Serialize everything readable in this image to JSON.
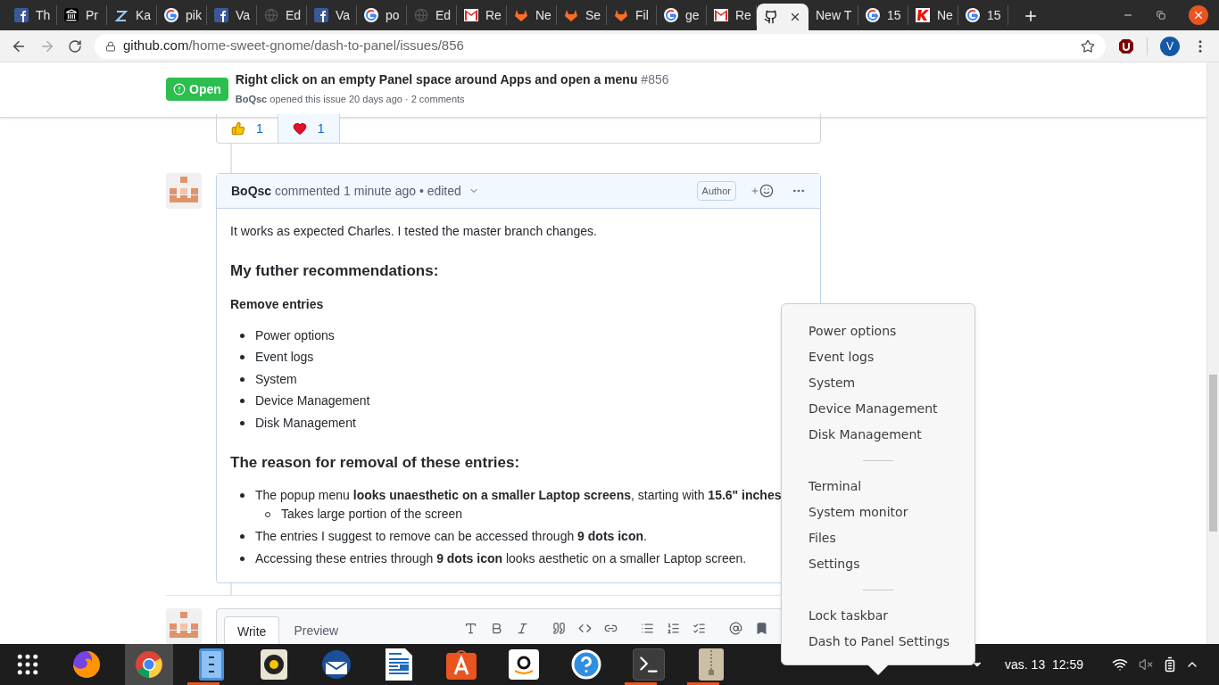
{
  "tabs": [
    {
      "label": "Th",
      "kind": "facebook",
      "selected": false
    },
    {
      "label": "Pr",
      "kind": "bank",
      "selected": false
    },
    {
      "label": "Ka",
      "kind": "z",
      "selected": false
    },
    {
      "label": "pik",
      "kind": "google",
      "selected": false
    },
    {
      "label": "Va",
      "kind": "facebook",
      "selected": false
    },
    {
      "label": "Ed",
      "kind": "globe",
      "selected": false
    },
    {
      "label": "Va",
      "kind": "facebook",
      "selected": false
    },
    {
      "label": "po",
      "kind": "google",
      "selected": false
    },
    {
      "label": "Ed",
      "kind": "globe",
      "selected": false
    },
    {
      "label": "Re",
      "kind": "mail",
      "selected": false
    },
    {
      "label": "Ne",
      "kind": "fox",
      "selected": false
    },
    {
      "label": "Se",
      "kind": "fox",
      "selected": false
    },
    {
      "label": "Fil",
      "kind": "fox",
      "selected": false
    },
    {
      "label": "ge",
      "kind": "google",
      "selected": false
    },
    {
      "label": "Re",
      "kind": "mail",
      "selected": false
    },
    {
      "kind": "octocat",
      "selected": true
    },
    {
      "label": "New T",
      "kind": "none",
      "selected": false
    },
    {
      "label": "15",
      "kind": "google",
      "selected": false
    },
    {
      "label": "Ne",
      "kind": "k",
      "selected": false
    },
    {
      "label": "15",
      "kind": "google",
      "selected": false
    }
  ],
  "address": {
    "host": "github.com",
    "path": "/home-sweet-gnome/dash-to-panel/issues/856"
  },
  "profile": {
    "initial": "V"
  },
  "issue": {
    "state": "Open",
    "title": "Right click on an empty Panel space around Apps and open a menu",
    "number": "#856",
    "meta": "**BoQsc** opened this issue 20 days ago · 2 comments"
  },
  "reactions": [
    {
      "kind": "thumbs",
      "count": "1",
      "selected": false
    },
    {
      "kind": "heart",
      "count": "1",
      "selected": true
    }
  ],
  "comment": {
    "author": "BoQsc",
    "meta": "commented 1 minute ago • edited",
    "badge": "Author",
    "paragraph": "It works as expected Charles. I tested the master branch changes.",
    "heading_1": "My futher recommendations:",
    "subheading": "Remove entries",
    "entries": [
      "Power options",
      "Event logs",
      "System",
      "Device Management",
      "Disk Management"
    ],
    "heading_2": "The reason for removal of these entries:",
    "reasons": [
      {
        "text": "The popup menu **looks unaesthetic on a smaller Laptop screens**, starting with **15.6\" inches**",
        "children": [
          {
            "text": "Takes large portion of the screen"
          }
        ]
      },
      {
        "text": "The entries I suggest to remove can be accessed through **9 dots icon**."
      },
      {
        "text": "Accessing these entries through **9 dots icon** looks aesthetic on a smaller Laptop screen."
      }
    ]
  },
  "editor": {
    "tabs": [
      {
        "label": "Write",
        "selected": true
      },
      {
        "label": "Preview",
        "selected": false
      }
    ]
  },
  "menu": {
    "sections": [
      [
        "Power options",
        "Event logs",
        "System",
        "Device Management",
        "Disk Management"
      ],
      [
        "Terminal",
        "System monitor",
        "Files",
        "Settings"
      ],
      [
        "Lock taskbar",
        "Dash to Panel Settings"
      ]
    ]
  },
  "taskbar": {
    "apps": [
      {
        "kind": "grid",
        "running": false,
        "selected": false
      },
      {
        "kind": "firefox",
        "running": false,
        "selected": false
      },
      {
        "kind": "chrome",
        "running": false,
        "selected": true
      },
      {
        "kind": "files",
        "running": true,
        "selected": false
      },
      {
        "kind": "music",
        "running": false,
        "selected": false
      },
      {
        "kind": "mail",
        "running": false,
        "selected": false
      },
      {
        "kind": "writer",
        "running": false,
        "selected": false
      },
      {
        "kind": "store",
        "running": false,
        "selected": false
      },
      {
        "kind": "amazon",
        "running": false,
        "selected": false
      },
      {
        "kind": "help",
        "running": false,
        "selected": false
      },
      {
        "kind": "terminal",
        "running": true,
        "selected": false
      },
      {
        "kind": "archive",
        "running": true,
        "selected": false
      }
    ],
    "clock": "vas. 13  12:59"
  }
}
